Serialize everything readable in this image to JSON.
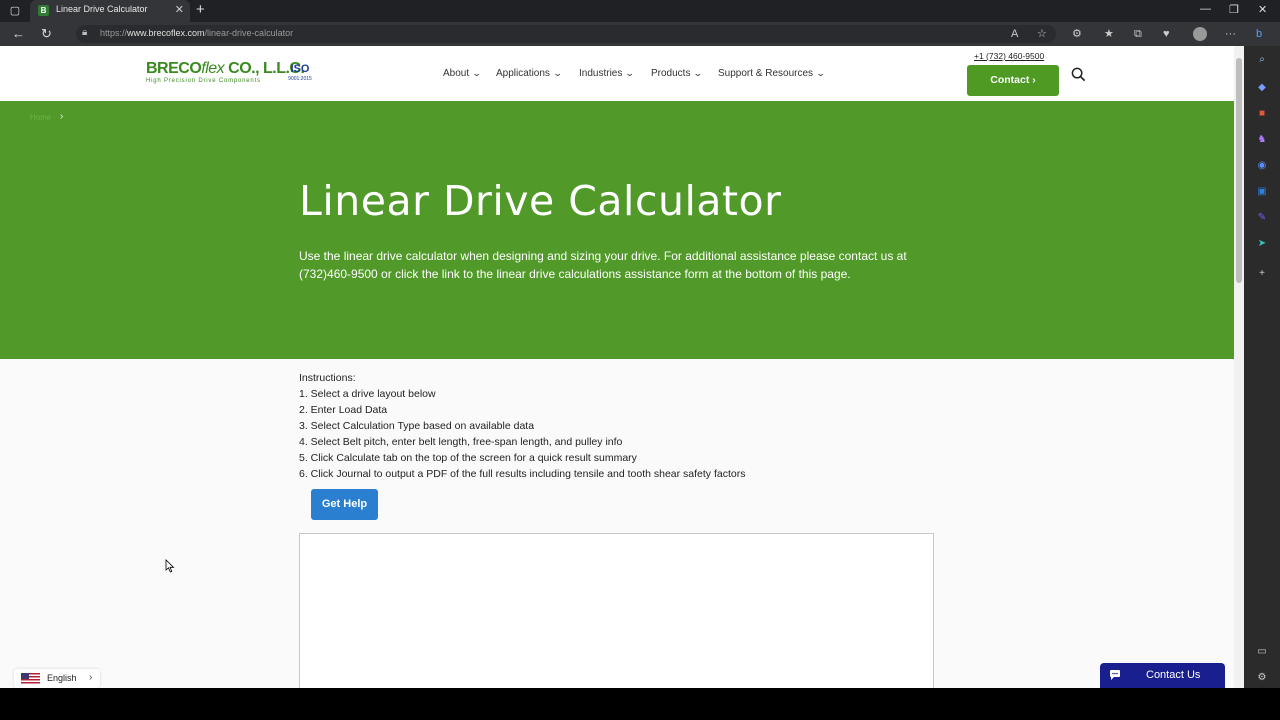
{
  "browser": {
    "tab_title": "Linear Drive Calculator",
    "tab_favicon": "B",
    "url_prefix": "https://",
    "url_domain": "www.brecoflex.com",
    "url_path": "/linear-drive-calculator"
  },
  "header": {
    "logo_brand": "BRECO",
    "logo_flex": "flex",
    "logo_company": " CO., L.L.C.",
    "logo_tagline": "High Precision Drive Components",
    "iso_label": "ISO",
    "iso_sub": "9001:2015",
    "menu": [
      {
        "label": "About"
      },
      {
        "label": "Applications"
      },
      {
        "label": "Industries"
      },
      {
        "label": "Products"
      },
      {
        "label": "Support & Resources"
      }
    ],
    "phone": "+1 (732) 460-9500",
    "contact_label": "Contact ›"
  },
  "hero": {
    "breadcrumb_home": "Home",
    "breadcrumb_sep": "›",
    "title": "Linear Drive Calculator",
    "description": "Use the linear drive calculator when designing and sizing your drive. For additional assistance please contact us at (732)460-9500 or click the link to the linear drive calculations assistance form at the bottom of this page."
  },
  "instructions": {
    "title": "Instructions:",
    "steps": [
      "1. Select a drive layout below",
      "2. Enter Load Data",
      "3. Select Calculation Type based on available data",
      "4. Select Belt pitch, enter belt length, free-span length, and pulley info",
      "5. Click Calculate tab on the top of the screen for a quick result summary",
      "6. Click Journal to output a PDF of the full results including tensile and tooth shear safety factors"
    ],
    "help_button": "Get Help"
  },
  "language": {
    "label": "English"
  },
  "chat": {
    "label": "Contact Us"
  },
  "colors": {
    "brand_green": "#519a29",
    "contact_green": "#4e9a23",
    "help_blue": "#2b7fd1",
    "chat_navy": "#1a1f8f"
  }
}
